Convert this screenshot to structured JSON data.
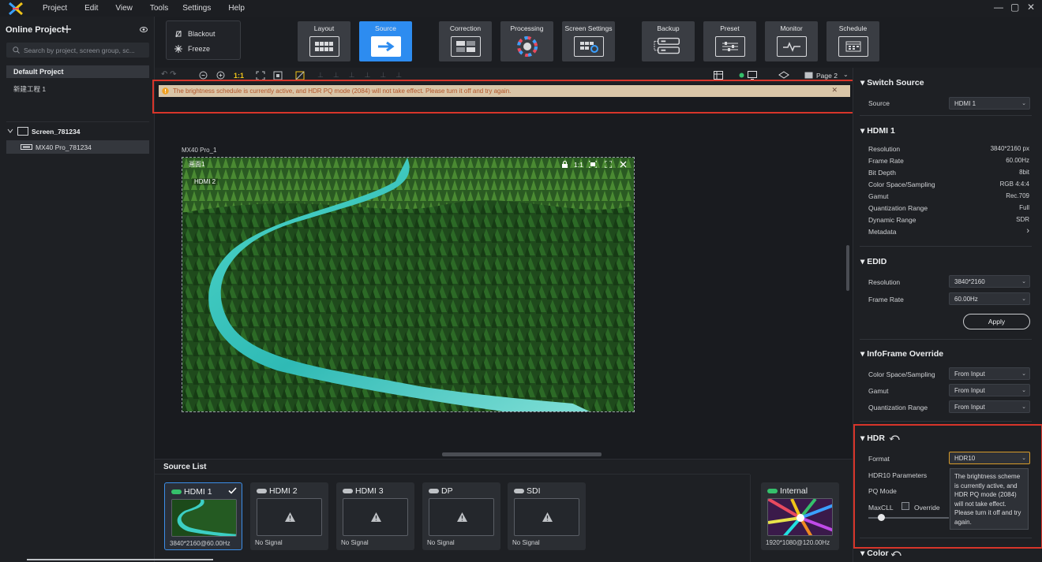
{
  "menubar": {
    "items": [
      "Project",
      "Edit",
      "View",
      "Tools",
      "Settings",
      "Help"
    ],
    "window_controls": [
      "—",
      "▢",
      "✕"
    ]
  },
  "left_panel": {
    "title": "Online Project",
    "search_placeholder": "Search by project, screen group, sc...",
    "project_header": "Default Project",
    "project_item": "新建工程 1",
    "screen_group": "Screen_781234",
    "device": "MX40 Pro_781234"
  },
  "toolbar": {
    "blackout_label": "Blackout",
    "freeze_label": "Freeze",
    "buttons": [
      "Layout",
      "Source",
      "Correction",
      "Processing",
      "Screen Settings",
      "Backup",
      "Preset",
      "Monitor",
      "Schedule"
    ],
    "active": "Source"
  },
  "canvas": {
    "zoom_label": "1:1",
    "page_label": "Page 2",
    "warning": "The brightness schedule is currently active, and HDR PQ mode (2084) will not take effect. Please turn it off and try again.",
    "device_label": "MX40 Pro_1",
    "screen_tab": "画面1",
    "hdmi_tag": "HDMI 2",
    "ratio_label": "1:1"
  },
  "source_list": {
    "title": "Source List",
    "cards": [
      {
        "name": "HDMI 1",
        "status": "3840*2160@60.00Hz",
        "signal": true,
        "selected": true
      },
      {
        "name": "HDMI 2",
        "status": "No Signal",
        "signal": false,
        "selected": false
      },
      {
        "name": "HDMI 3",
        "status": "No Signal",
        "signal": false,
        "selected": false
      },
      {
        "name": "DP",
        "status": "No Signal",
        "signal": false,
        "selected": false
      },
      {
        "name": "SDI",
        "status": "No Signal",
        "signal": false,
        "selected": false
      }
    ],
    "internal": {
      "name": "Internal",
      "status": "1920*1080@120.00Hz"
    }
  },
  "right_panel": {
    "switch_source": {
      "title": "Switch Source",
      "source_label": "Source",
      "source_value": "HDMI 1"
    },
    "hdmi": {
      "title": "HDMI 1",
      "rows": [
        {
          "label": "Resolution",
          "value": "3840*2160 px"
        },
        {
          "label": "Frame Rate",
          "value": "60.00Hz"
        },
        {
          "label": "Bit Depth",
          "value": "8bit"
        },
        {
          "label": "Color Space/Sampling",
          "value": "RGB 4:4:4"
        },
        {
          "label": "Gamut",
          "value": "Rec.709"
        },
        {
          "label": "Quantization Range",
          "value": "Full"
        },
        {
          "label": "Dynamic Range",
          "value": "SDR"
        },
        {
          "label": "Metadata",
          "value": "›"
        }
      ]
    },
    "edid": {
      "title": "EDID",
      "resolution_label": "Resolution",
      "resolution_value": "3840*2160",
      "framerate_label": "Frame Rate",
      "framerate_value": "60.00Hz",
      "apply": "Apply"
    },
    "infoframe": {
      "title": "InfoFrame Override",
      "rows": [
        {
          "label": "Color Space/Sampling",
          "value": "From Input"
        },
        {
          "label": "Gamut",
          "value": "From Input"
        },
        {
          "label": "Quantization Range",
          "value": "From Input"
        }
      ]
    },
    "hdr": {
      "title": "HDR",
      "format_label": "Format",
      "format_value": "HDR10",
      "params_label": "HDR10 Parameters",
      "pq_label": "PQ Mode",
      "maxcll_label": "MaxCLL",
      "override_label": "Override",
      "tooltip": "The brightness scheme is currently active, and HDR PQ mode (2084) will not take effect. Please turn it off and try again."
    },
    "color": {
      "title": "Color"
    }
  }
}
